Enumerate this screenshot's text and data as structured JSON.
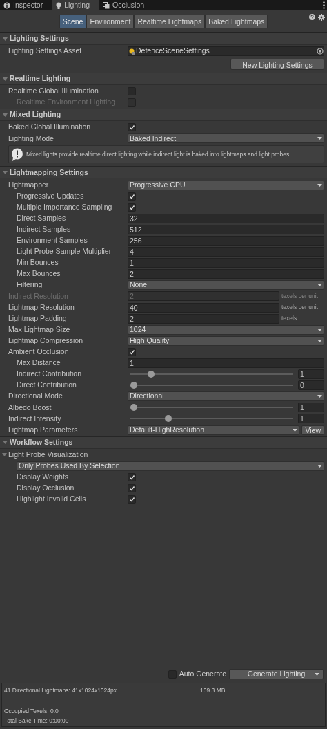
{
  "window_tabs": [
    {
      "label": "Inspector",
      "selected": false
    },
    {
      "label": "Lighting",
      "selected": true
    },
    {
      "label": "Occlusion",
      "selected": false
    }
  ],
  "toolbar": [
    {
      "label": "Scene",
      "selected": true
    },
    {
      "label": "Environment",
      "selected": false
    },
    {
      "label": "Realtime Lightmaps",
      "selected": false
    },
    {
      "label": "Baked Lightmaps",
      "selected": false
    }
  ],
  "sections": [
    {
      "title": "Lighting Settings",
      "expanded": true,
      "items": [
        {
          "kind": "object",
          "label": "Lighting Settings Asset",
          "value": "DefenceSceneSettings"
        },
        {
          "kind": "button",
          "label": "New Lighting Settings"
        }
      ]
    },
    {
      "title": "Realtime Lighting",
      "expanded": true,
      "items": [
        {
          "kind": "toggle",
          "label": "Realtime Global Illumination",
          "checked": false,
          "disabled": false,
          "children": [
            {
              "kind": "toggle",
              "label": "Realtime Environment Lighting",
              "checked": false,
              "disabled": true
            }
          ]
        }
      ]
    },
    {
      "title": "Mixed Lighting",
      "expanded": true,
      "items": [
        {
          "kind": "toggle",
          "label": "Baked Global Illumination",
          "checked": true,
          "disabled": false
        },
        {
          "kind": "dropdown",
          "label": "Lighting Mode",
          "value": "Baked Indirect"
        },
        {
          "kind": "help",
          "text": "Mixed lights provide realtime direct lighting while indirect light is baked into lightmaps and light probes."
        }
      ]
    },
    {
      "title": "Lightmapping Settings",
      "expanded": true,
      "items": [
        {
          "kind": "dropdown",
          "label": "Lightmapper",
          "value": "Progressive CPU",
          "children": [
            {
              "kind": "toggle",
              "label": "Progressive Updates",
              "checked": true,
              "disabled": false
            },
            {
              "kind": "toggle",
              "label": "Multiple Importance Sampling",
              "checked": true,
              "disabled": false
            },
            {
              "kind": "field",
              "label": "Direct Samples",
              "value": "32",
              "disabled": false
            },
            {
              "kind": "field",
              "label": "Indirect Samples",
              "value": "512",
              "disabled": false
            },
            {
              "kind": "field",
              "label": "Environment Samples",
              "value": "256",
              "disabled": false
            },
            {
              "kind": "field",
              "label": "Light Probe Sample Multiplier",
              "value": "4",
              "disabled": false
            },
            {
              "kind": "field",
              "label": "Min Bounces",
              "value": "1",
              "disabled": false
            },
            {
              "kind": "field",
              "label": "Max Bounces",
              "value": "2",
              "disabled": false
            },
            {
              "kind": "dropdown",
              "label": "Filtering",
              "value": "None"
            }
          ]
        },
        {
          "kind": "field",
          "label": "Indirect Resolution",
          "value": "2",
          "units": "texels per unit",
          "disabled": true
        },
        {
          "kind": "field",
          "label": "Lightmap Resolution",
          "value": "40",
          "units": "texels per unit",
          "disabled": false
        },
        {
          "kind": "field",
          "label": "Lightmap Padding",
          "value": "2",
          "units": "texels",
          "disabled": false
        },
        {
          "kind": "dropdown",
          "label": "Max Lightmap Size",
          "value": "1024"
        },
        {
          "kind": "dropdown",
          "label": "Lightmap Compression",
          "value": "High Quality"
        },
        {
          "kind": "toggle",
          "label": "Ambient Occlusion",
          "checked": true,
          "disabled": false,
          "children": [
            {
              "kind": "field",
              "label": "Max Distance",
              "value": "1",
              "disabled": false
            },
            {
              "kind": "slider",
              "label": "Indirect Contribution",
              "level": 0.11,
              "value": "1"
            },
            {
              "kind": "slider",
              "label": "Direct Contribution",
              "level": 0,
              "value": "0"
            }
          ]
        },
        {
          "kind": "dropdown",
          "label": "Directional Mode",
          "value": "Directional"
        },
        {
          "kind": "slider",
          "label": "Albedo Boost",
          "level": 0,
          "value": "1"
        },
        {
          "kind": "slider",
          "label": "Indirect Intensity",
          "level": 0.22,
          "value": "1"
        },
        {
          "kind": "dropdown",
          "label": "Lightmap Parameters",
          "value": "Default-HighResolution",
          "button": "View"
        }
      ]
    },
    {
      "title": "Workflow Settings",
      "expanded": true,
      "items": [
        {
          "kind": "foldout",
          "label": "Light Probe Visualization",
          "expanded": true,
          "children": [
            {
              "kind": "dropdown",
              "value": "Only Probes Used By Selection"
            },
            {
              "kind": "toggle",
              "label": "Display Weights",
              "checked": true,
              "disabled": false
            },
            {
              "kind": "toggle",
              "label": "Display Occlusion",
              "checked": true,
              "disabled": false
            },
            {
              "kind": "toggle",
              "label": "Highlight Invalid Cells",
              "checked": true,
              "disabled": false
            }
          ]
        }
      ]
    }
  ],
  "footer": {
    "auto_generate": {
      "label": "Auto Generate",
      "checked": false
    },
    "generate_button": "Generate Lighting",
    "stats": [
      {
        "text": "41 Directional Lightmaps: 41x1024x1024px",
        "value": "109.3 MB"
      },
      {
        "text": "Occupied Texels: 0.0"
      },
      {
        "text": "Total Bake Time: 0:00:00"
      }
    ]
  }
}
